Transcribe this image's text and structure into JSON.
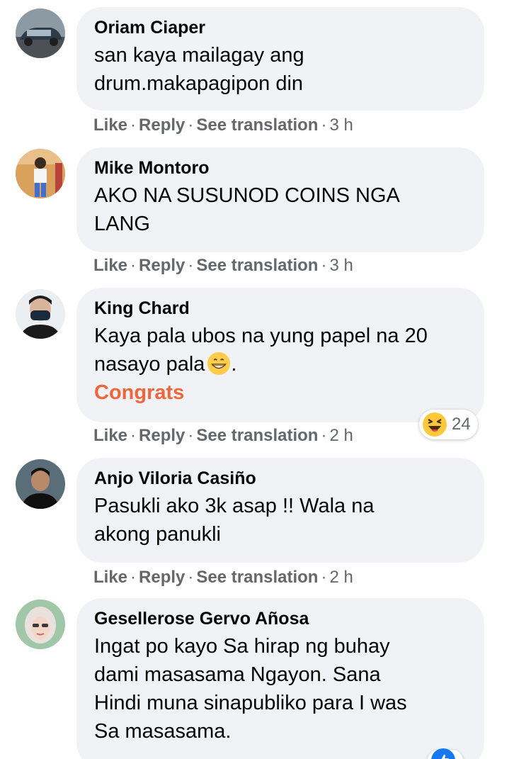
{
  "actions": {
    "like": "Like",
    "reply": "Reply",
    "see_translation": "See translation",
    "separator": "·"
  },
  "comments": [
    {
      "author": "Oriam Ciaper",
      "lines": [
        "san kaya mailagay ang",
        "drum.makapagipon din"
      ],
      "time": "3 h"
    },
    {
      "author": "Mike Montoro",
      "lines": [
        "AKO NA SUSUNOD COINS NGA",
        "LANG"
      ],
      "time": "3 h"
    },
    {
      "author": "King Chard",
      "lines": [
        "Kaya pala ubos na yung papel na 20",
        "nasayo pala"
      ],
      "emoji": "grinning-face-emoji",
      "highlight": "Congrats",
      "highlight_color": "#f0653b",
      "time": "2 h",
      "reaction": {
        "icon": "laughing-face-icon",
        "count": "24"
      }
    },
    {
      "author": "Anjo Viloria Casiño",
      "lines": [
        "Pasukli ako 3k asap !! Wala na",
        "akong panukli"
      ],
      "time": "2 h"
    },
    {
      "author": "Gesellerose Gervo Añosa",
      "lines": [
        "Ingat po kayo Sa hirap ng buhay",
        "dami masasama Ngayon. Sana",
        "Hindi muna sinapubliko para I was",
        "Sa masasama."
      ]
    }
  ],
  "colors": {
    "bubble": "#f0f2f5",
    "meta": "#65676b",
    "reaction_blue": "#1877f2"
  }
}
